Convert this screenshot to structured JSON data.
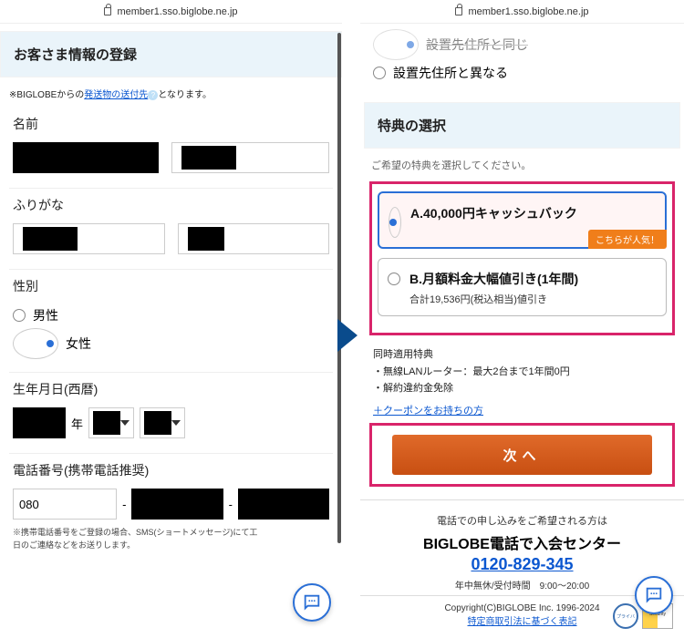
{
  "url": "member1.sso.biglobe.ne.jp",
  "left": {
    "section_title": "お客さま情報の登録",
    "note_prefix": "※BIGLOBEからの",
    "note_link": "発送物の送付先",
    "note_suffix": "となります。",
    "labels": {
      "name": "名前",
      "furigana": "ふりがな",
      "gender": "性別",
      "dob": "生年月日(西暦)",
      "tel": "電話番号(携帯電話推奨)"
    },
    "gender_options": {
      "male": "男性",
      "female": "女性"
    },
    "year_unit": "年",
    "tel_first": "080",
    "tel_dash": "-",
    "fine1": "※携帯電話番号をご登録の場合、SMS(ショートメッセージ)にて工",
    "fine2": "日のご連絡などをお送りします。"
  },
  "right": {
    "addr_option_partial": "設置先住所と同じ",
    "addr_option_diff": "設置先住所と異なる",
    "benefit_head": "特典の選択",
    "benefit_note": "ご希望の特典を選択してください。",
    "optA_title": "A.40,000円キャッシュバック",
    "optA_badge": "こちらが人気！",
    "optB_title": "B.月額料金大幅値引き(1年間)",
    "optB_sub": "合計19,536円(税込相当)値引き",
    "simul_head": "同時適用特典",
    "simul_1": "・無線LANルーター：最大2台まで1年間0円",
    "simul_2": "・解約違約金免除",
    "coupon_link": "＋クーポンをお持ちの方",
    "next": "次へ",
    "tel_apply_1": "電話での申し込みをご希望される方は",
    "tel_apply_2": "BIGLOBE電話で入会センター",
    "tel_apply_num": "0120-829-345",
    "tel_apply_hours": "年中無休/受付時間　9:00～20:00",
    "copyright": "Copyright(C)BIGLOBE Inc. 1996-2024",
    "footer_link": "特定商取引法に基づく表記"
  }
}
